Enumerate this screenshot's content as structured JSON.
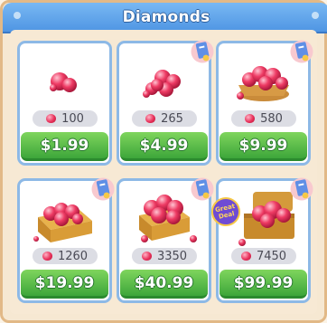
{
  "window": {
    "title": "Diamonds"
  },
  "colors": {
    "title_bar": "#5aa2ea",
    "card_border": "#8db9e6",
    "price_button": "#46ad3f",
    "gem": "#e8305a",
    "panel_bg": "#f6e8d2"
  },
  "offers": [
    {
      "amount": "100",
      "price": "$1.99",
      "art": "single-gem-pile-icon",
      "bonus": false,
      "badge": ""
    },
    {
      "amount": "265",
      "price": "$4.99",
      "art": "small-gem-pile-icon",
      "bonus": true,
      "badge": ""
    },
    {
      "amount": "580",
      "price": "$9.99",
      "art": "gem-basket-icon",
      "bonus": true,
      "badge": ""
    },
    {
      "amount": "1260",
      "price": "$19.99",
      "art": "gem-crate-icon",
      "bonus": true,
      "badge": ""
    },
    {
      "amount": "3350",
      "price": "$40.99",
      "art": "large-gem-crate-icon",
      "bonus": true,
      "badge": ""
    },
    {
      "amount": "7450",
      "price": "$99.99",
      "art": "gem-treasure-chest-icon",
      "bonus": true,
      "badge": "Great Deal"
    }
  ]
}
